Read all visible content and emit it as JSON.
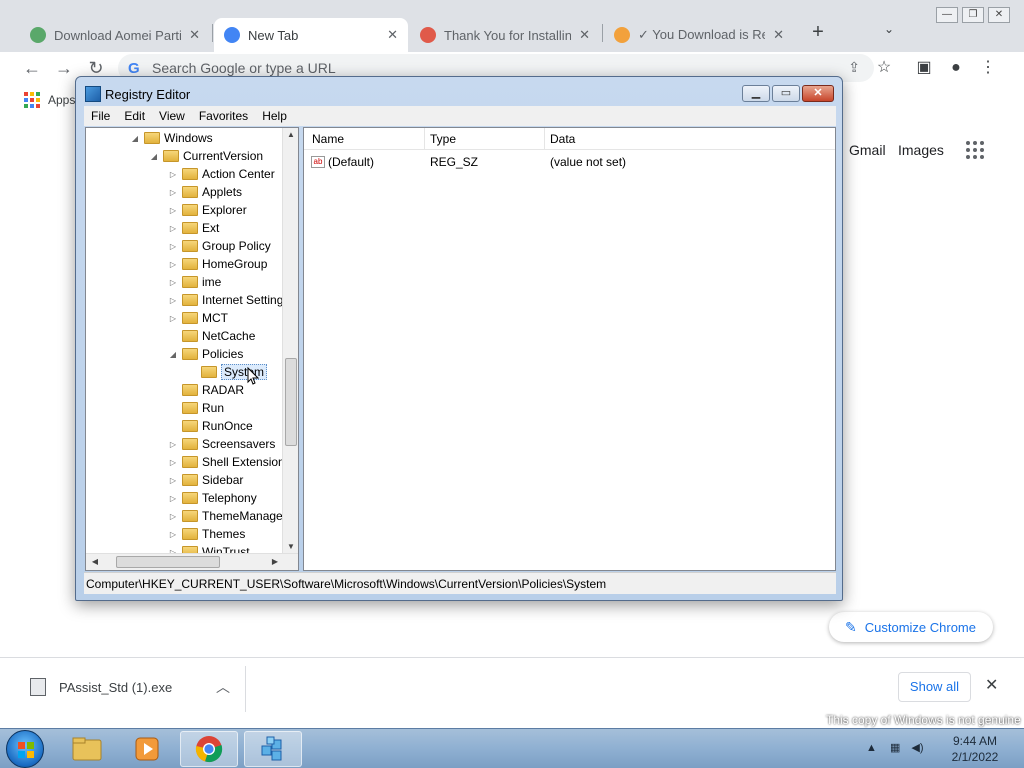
{
  "chrome": {
    "tabs": [
      {
        "title": "Download Aomei Partitio",
        "fav_color": "#5aa86a"
      },
      {
        "title": "New Tab",
        "fav_color": "#4285f4"
      },
      {
        "title": "Thank You for Installing",
        "fav_color": "#e05a4a"
      },
      {
        "title": "✓ You Download is Rea",
        "fav_color": "#f2a13c"
      }
    ],
    "new_tab": "+",
    "tab_search": "⌄",
    "omnibox_placeholder": "Search Google or type a URL",
    "bookmarks_apps": "Apps",
    "gmail": "Gmail",
    "images": "Images",
    "customize": "Customize Chrome"
  },
  "download": {
    "filename": "PAssist_Std (1).exe",
    "show_all": "Show all"
  },
  "regedit": {
    "title": "Registry Editor",
    "menu": [
      "File",
      "Edit",
      "View",
      "Favorites",
      "Help"
    ],
    "tree": [
      {
        "label": "Windows",
        "indent": 0,
        "exp": "◢"
      },
      {
        "label": "CurrentVersion",
        "indent": 1,
        "exp": "◢"
      },
      {
        "label": "Action Center",
        "indent": 2,
        "exp": "▷"
      },
      {
        "label": "Applets",
        "indent": 2,
        "exp": "▷"
      },
      {
        "label": "Explorer",
        "indent": 2,
        "exp": "▷"
      },
      {
        "label": "Ext",
        "indent": 2,
        "exp": "▷"
      },
      {
        "label": "Group Policy",
        "indent": 2,
        "exp": "▷"
      },
      {
        "label": "HomeGroup",
        "indent": 2,
        "exp": "▷"
      },
      {
        "label": "ime",
        "indent": 2,
        "exp": "▷"
      },
      {
        "label": "Internet Settings",
        "indent": 2,
        "exp": "▷"
      },
      {
        "label": "MCT",
        "indent": 2,
        "exp": "▷"
      },
      {
        "label": "NetCache",
        "indent": 2,
        "exp": ""
      },
      {
        "label": "Policies",
        "indent": 2,
        "exp": "◢"
      },
      {
        "label": "System",
        "indent": 3,
        "exp": "",
        "selected": true
      },
      {
        "label": "RADAR",
        "indent": 2,
        "exp": ""
      },
      {
        "label": "Run",
        "indent": 2,
        "exp": ""
      },
      {
        "label": "RunOnce",
        "indent": 2,
        "exp": ""
      },
      {
        "label": "Screensavers",
        "indent": 2,
        "exp": "▷"
      },
      {
        "label": "Shell Extensions",
        "indent": 2,
        "exp": "▷"
      },
      {
        "label": "Sidebar",
        "indent": 2,
        "exp": "▷"
      },
      {
        "label": "Telephony",
        "indent": 2,
        "exp": "▷"
      },
      {
        "label": "ThemeManager",
        "indent": 2,
        "exp": "▷"
      },
      {
        "label": "Themes",
        "indent": 2,
        "exp": "▷"
      },
      {
        "label": "WinTrust",
        "indent": 2,
        "exp": "▷"
      }
    ],
    "columns": [
      "Name",
      "Type",
      "Data"
    ],
    "values": [
      {
        "name": "(Default)",
        "type": "REG_SZ",
        "data": "(value not set)"
      }
    ],
    "status_path": "Computer\\HKEY_CURRENT_USER\\Software\\Microsoft\\Windows\\CurrentVersion\\Policies\\System"
  },
  "taskbar": {
    "time": "9:44 AM",
    "date": "2/1/2022"
  },
  "watermark": "This copy of Windows is not genuine"
}
